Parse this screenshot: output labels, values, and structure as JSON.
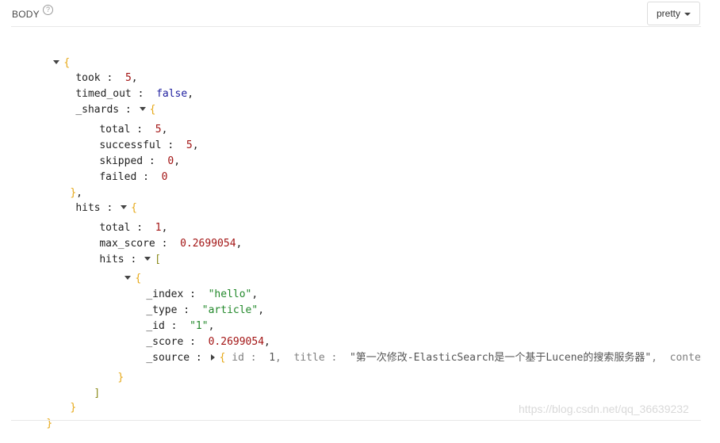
{
  "header": {
    "label": "BODY",
    "help_glyph": "?",
    "format_button": "pretty"
  },
  "json_view": {
    "open_brace": "{",
    "close_brace": "}",
    "took": {
      "key": "took",
      "value": "5"
    },
    "timed_out": {
      "key": "timed_out",
      "value": "false"
    },
    "shards": {
      "key": "_shards",
      "total": {
        "key": "total",
        "value": "5"
      },
      "successful": {
        "key": "successful",
        "value": "5"
      },
      "skipped": {
        "key": "skipped",
        "value": "0"
      },
      "failed": {
        "key": "failed",
        "value": "0"
      }
    },
    "hits": {
      "key": "hits",
      "total": {
        "key": "total",
        "value": "1"
      },
      "max_score": {
        "key": "max_score",
        "value": "0.2699054"
      },
      "hits_array": {
        "key": "hits",
        "doc": {
          "index": {
            "key": "_index",
            "value": "\"hello\""
          },
          "type": {
            "key": "_type",
            "value": "\"article\""
          },
          "id": {
            "key": "_id",
            "value": "\"1\""
          },
          "score": {
            "key": "_score",
            "value": "0.2699054"
          },
          "source": {
            "key": "_source",
            "preview_id_key": "id",
            "preview_id_value": "1",
            "preview_title_key": "title",
            "preview_title_value": "\"第一次修改-ElasticSearch是一个基于Lucene的搜索服务器\"",
            "preview_content_key": "content"
          }
        }
      }
    }
  },
  "watermark": "https://blog.csdn.net/qq_36639232"
}
